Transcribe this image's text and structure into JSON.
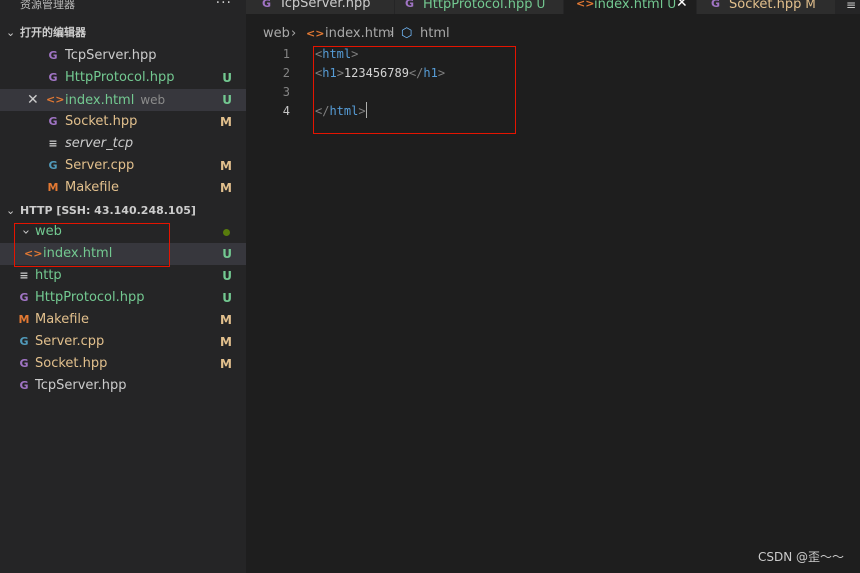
{
  "sidebar": {
    "title": "资源管理器",
    "more": "···",
    "open_editors": {
      "header": "打开的编辑器",
      "items": [
        {
          "icon": "G",
          "name": "TcpServer.hpp",
          "desc": "",
          "badge": ""
        },
        {
          "icon": "G",
          "name": "HttpProtocol.hpp",
          "desc": "",
          "badge": "U"
        },
        {
          "icon": "<>",
          "name": "index.html",
          "desc": "web",
          "badge": "U",
          "close": "✕"
        },
        {
          "icon": "G",
          "name": "Socket.hpp",
          "desc": "",
          "badge": "M"
        },
        {
          "icon": "≡",
          "name": "server_tcp",
          "desc": "",
          "badge": ""
        },
        {
          "icon": "G",
          "name": "Server.cpp",
          "desc": "",
          "badge": "M"
        },
        {
          "icon": "M",
          "name": "Makefile",
          "desc": "",
          "badge": "M"
        }
      ]
    },
    "workspace": {
      "header": "HTTP [SSH: 43.140.248.105]",
      "items": [
        {
          "icon": "›",
          "name": "web",
          "badge": ""
        },
        {
          "icon": "<>",
          "name": "index.html",
          "badge": "U"
        },
        {
          "icon": "≡",
          "name": "http",
          "badge": "U"
        },
        {
          "icon": "G",
          "name": "HttpProtocol.hpp",
          "badge": "U"
        },
        {
          "icon": "M",
          "name": "Makefile",
          "badge": "M"
        },
        {
          "icon": "G",
          "name": "Server.cpp",
          "badge": "M"
        },
        {
          "icon": "G",
          "name": "Socket.hpp",
          "badge": "M"
        },
        {
          "icon": "G",
          "name": "TcpServer.hpp",
          "badge": ""
        }
      ]
    }
  },
  "tabs": [
    {
      "icon": "G",
      "name": "TcpServer.hpp",
      "badge": ""
    },
    {
      "icon": "G",
      "name": "HttpProtocol.hpp",
      "badge": "U"
    },
    {
      "icon": "<>",
      "name": "index.html",
      "badge": "U",
      "close": "✕"
    },
    {
      "icon": "G",
      "name": "Socket.hpp",
      "badge": "M"
    }
  ],
  "tab_overflow": "≡",
  "breadcrumb": {
    "folder": "web",
    "file": "index.html",
    "symbol": "html"
  },
  "editor": {
    "lines": [
      {
        "num": "1",
        "open": "<",
        "tag": "html",
        "close": ">",
        "text": "",
        "open2": "",
        "tag2": "",
        "close2": ""
      },
      {
        "num": "2",
        "open": "<",
        "tag": "h1",
        "close": ">",
        "text": "123456789",
        "open2": "</",
        "tag2": "h1",
        "close2": ">"
      },
      {
        "num": "3",
        "open": "",
        "tag": "",
        "close": "",
        "text": "",
        "open2": "",
        "tag2": "",
        "close2": ""
      },
      {
        "num": "4",
        "open": "</",
        "tag": "html",
        "close": ">",
        "text": "",
        "open2": "",
        "tag2": "",
        "close2": ""
      }
    ]
  },
  "watermark": "CSDN @歪～～",
  "colors": {
    "background": "#1e1e1e",
    "sidebar": "#252526",
    "untracked": "#73c991",
    "modified": "#e2c08d",
    "highlight_box": "#e51400"
  }
}
